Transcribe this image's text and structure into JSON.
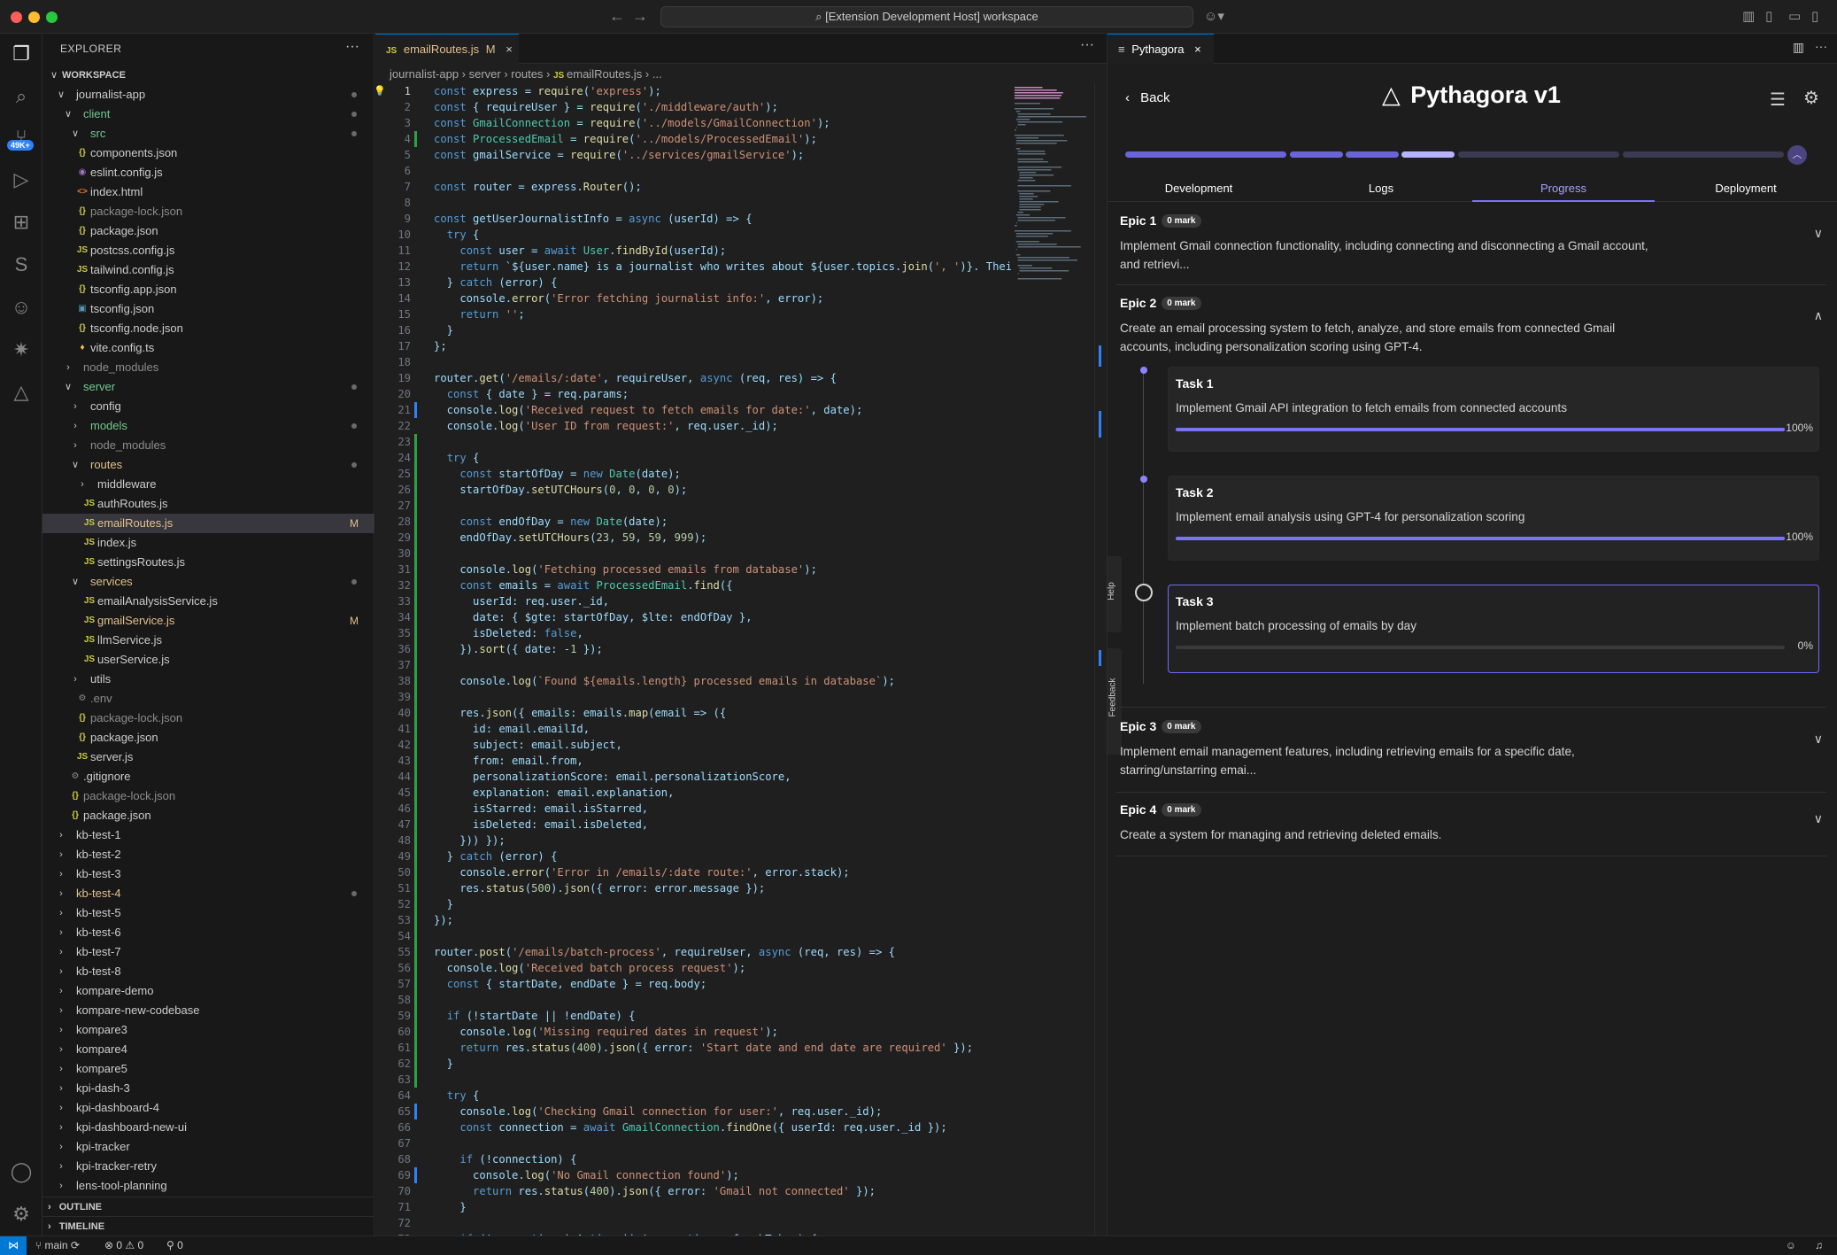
{
  "window": {
    "command_center": "[Extension Development Host] workspace"
  },
  "activity_bar": {
    "badge": "49K+"
  },
  "explorer": {
    "title": "EXPLORER",
    "workspace": "WORKSPACE",
    "items": [
      {
        "label": "journalist-app",
        "depth": 0,
        "type": "folder",
        "open": true,
        "dot": true
      },
      {
        "label": "client",
        "depth": 1,
        "type": "folder",
        "open": true,
        "dot": true,
        "color": "green"
      },
      {
        "label": "src",
        "depth": 2,
        "type": "folder",
        "open": true,
        "dot": true,
        "color": "green"
      },
      {
        "label": "components.json",
        "depth": 2,
        "type": "json"
      },
      {
        "label": "eslint.config.js",
        "depth": 2,
        "type": "eslint"
      },
      {
        "label": "index.html",
        "depth": 2,
        "type": "html"
      },
      {
        "label": "package-lock.json",
        "depth": 2,
        "type": "json",
        "color": "dim"
      },
      {
        "label": "package.json",
        "depth": 2,
        "type": "json"
      },
      {
        "label": "postcss.config.js",
        "depth": 2,
        "type": "js"
      },
      {
        "label": "tailwind.config.js",
        "depth": 2,
        "type": "js"
      },
      {
        "label": "tsconfig.app.json",
        "depth": 2,
        "type": "json"
      },
      {
        "label": "tsconfig.json",
        "depth": 2,
        "type": "ts"
      },
      {
        "label": "tsconfig.node.json",
        "depth": 2,
        "type": "json"
      },
      {
        "label": "vite.config.ts",
        "depth": 2,
        "type": "vite"
      },
      {
        "label": "node_modules",
        "depth": 1,
        "type": "folder",
        "open": false,
        "color": "dim"
      },
      {
        "label": "server",
        "depth": 1,
        "type": "folder",
        "open": true,
        "dot": true,
        "color": "green"
      },
      {
        "label": "config",
        "depth": 2,
        "type": "folder",
        "open": false
      },
      {
        "label": "models",
        "depth": 2,
        "type": "folder",
        "open": false,
        "dot": true,
        "color": "green"
      },
      {
        "label": "node_modules",
        "depth": 2,
        "type": "folder",
        "open": false,
        "color": "dim"
      },
      {
        "label": "routes",
        "depth": 2,
        "type": "folder",
        "open": true,
        "dot": true,
        "color": "gold"
      },
      {
        "label": "middleware",
        "depth": 3,
        "type": "folder",
        "open": false
      },
      {
        "label": "authRoutes.js",
        "depth": 3,
        "type": "js"
      },
      {
        "label": "emailRoutes.js",
        "depth": 3,
        "type": "js",
        "selected": true,
        "mod": "M",
        "color": "gold"
      },
      {
        "label": "index.js",
        "depth": 3,
        "type": "js"
      },
      {
        "label": "settingsRoutes.js",
        "depth": 3,
        "type": "js"
      },
      {
        "label": "services",
        "depth": 2,
        "type": "folder",
        "open": true,
        "dot": true,
        "color": "gold"
      },
      {
        "label": "emailAnalysisService.js",
        "depth": 3,
        "type": "js"
      },
      {
        "label": "gmailService.js",
        "depth": 3,
        "type": "js",
        "mod": "M",
        "color": "gold"
      },
      {
        "label": "llmService.js",
        "depth": 3,
        "type": "js"
      },
      {
        "label": "userService.js",
        "depth": 3,
        "type": "js"
      },
      {
        "label": "utils",
        "depth": 2,
        "type": "folder",
        "open": false
      },
      {
        "label": ".env",
        "depth": 2,
        "type": "gear",
        "color": "dim"
      },
      {
        "label": "package-lock.json",
        "depth": 2,
        "type": "json",
        "color": "dim"
      },
      {
        "label": "package.json",
        "depth": 2,
        "type": "json"
      },
      {
        "label": "server.js",
        "depth": 2,
        "type": "js"
      },
      {
        "label": ".gitignore",
        "depth": 1,
        "type": "gear"
      },
      {
        "label": "package-lock.json",
        "depth": 1,
        "type": "json",
        "color": "dim"
      },
      {
        "label": "package.json",
        "depth": 1,
        "type": "json"
      },
      {
        "label": "kb-test-1",
        "depth": 0,
        "type": "folder",
        "open": false
      },
      {
        "label": "kb-test-2",
        "depth": 0,
        "type": "folder",
        "open": false
      },
      {
        "label": "kb-test-3",
        "depth": 0,
        "type": "folder",
        "open": false
      },
      {
        "label": "kb-test-4",
        "depth": 0,
        "type": "folder",
        "open": false,
        "dot": true,
        "color": "gold"
      },
      {
        "label": "kb-test-5",
        "depth": 0,
        "type": "folder",
        "open": false
      },
      {
        "label": "kb-test-6",
        "depth": 0,
        "type": "folder",
        "open": false
      },
      {
        "label": "kb-test-7",
        "depth": 0,
        "type": "folder",
        "open": false
      },
      {
        "label": "kb-test-8",
        "depth": 0,
        "type": "folder",
        "open": false
      },
      {
        "label": "kompare-demo",
        "depth": 0,
        "type": "folder",
        "open": false
      },
      {
        "label": "kompare-new-codebase",
        "depth": 0,
        "type": "folder",
        "open": false
      },
      {
        "label": "kompare3",
        "depth": 0,
        "type": "folder",
        "open": false
      },
      {
        "label": "kompare4",
        "depth": 0,
        "type": "folder",
        "open": false
      },
      {
        "label": "kompare5",
        "depth": 0,
        "type": "folder",
        "open": false
      },
      {
        "label": "kpi-dash-3",
        "depth": 0,
        "type": "folder",
        "open": false
      },
      {
        "label": "kpi-dashboard-4",
        "depth": 0,
        "type": "folder",
        "open": false
      },
      {
        "label": "kpi-dashboard-new-ui",
        "depth": 0,
        "type": "folder",
        "open": false
      },
      {
        "label": "kpi-tracker",
        "depth": 0,
        "type": "folder",
        "open": false
      },
      {
        "label": "kpi-tracker-retry",
        "depth": 0,
        "type": "folder",
        "open": false
      },
      {
        "label": "lens-tool-planning",
        "depth": 0,
        "type": "folder",
        "open": false
      }
    ],
    "outline": "OUTLINE",
    "timeline": "TIMELINE"
  },
  "editor": {
    "tab_label": "emailRoutes.js",
    "tab_icon": "JS",
    "tab_mod": "M",
    "breadcrumbs": [
      "journalist-app",
      "server",
      "routes",
      "emailRoutes.js",
      "..."
    ],
    "current_line": 1,
    "lines": [
      "const express = require('express');",
      "const { requireUser } = require('./middleware/auth');",
      "const GmailConnection = require('../models/GmailConnection');",
      "const ProcessedEmail = require('../models/ProcessedEmail');",
      "const gmailService = require('../services/gmailService');",
      "",
      "const router = express.Router();",
      "",
      "const getUserJournalistInfo = async (userId) => {",
      "  try {",
      "    const user = await User.findById(userId);",
      "    return `${user.name} is a journalist who writes about ${user.topics.join(', ')}. Their",
      "  } catch (error) {",
      "    console.error('Error fetching journalist info:', error);",
      "    return '';",
      "  }",
      "};",
      "",
      "router.get('/emails/:date', requireUser, async (req, res) => {",
      "  const { date } = req.params;",
      "  console.log('Received request to fetch emails for date:', date);",
      "  console.log('User ID from request:', req.user._id);",
      "",
      "  try {",
      "    const startOfDay = new Date(date);",
      "    startOfDay.setUTCHours(0, 0, 0, 0);",
      "",
      "    const endOfDay = new Date(date);",
      "    endOfDay.setUTCHours(23, 59, 59, 999);",
      "",
      "    console.log('Fetching processed emails from database');",
      "    const emails = await ProcessedEmail.find({",
      "      userId: req.user._id,",
      "      date: { $gte: startOfDay, $lte: endOfDay },",
      "      isDeleted: false,",
      "    }).sort({ date: -1 });",
      "",
      "    console.log(`Found ${emails.length} processed emails in database`);",
      "",
      "    res.json({ emails: emails.map(email => ({",
      "      id: email.emailId,",
      "      subject: email.subject,",
      "      from: email.from,",
      "      personalizationScore: email.personalizationScore,",
      "      explanation: email.explanation,",
      "      isStarred: email.isStarred,",
      "      isDeleted: email.isDeleted,",
      "    })) });",
      "  } catch (error) {",
      "    console.error('Error in /emails/:date route:', error.stack);",
      "    res.status(500).json({ error: error.message });",
      "  }",
      "});",
      "",
      "router.post('/emails/batch-process', requireUser, async (req, res) => {",
      "  console.log('Received batch process request');",
      "  const { startDate, endDate } = req.body;",
      "",
      "  if (!startDate || !endDate) {",
      "    console.log('Missing required dates in request');",
      "    return res.status(400).json({ error: 'Start date and end date are required' });",
      "  }",
      "",
      "  try {",
      "    console.log('Checking Gmail connection for user:', req.user._id);",
      "    const connection = await GmailConnection.findOne({ userId: req.user._id });",
      "",
      "    if (!connection) {",
      "      console.log('No Gmail connection found');",
      "      return res.status(400).json({ error: 'Gmail not connected' });",
      "    }",
      "",
      "    if (!connection.isActive || !connection.refreshToken) {"
    ]
  },
  "pythagora": {
    "tab_label": "Pythagora",
    "back_label": "Back",
    "brand": "Pythagora v1",
    "tabs": [
      {
        "label": "Development",
        "active": false
      },
      {
        "label": "Logs",
        "active": false
      },
      {
        "label": "Progress",
        "active": true
      },
      {
        "label": "Deployment",
        "active": false
      }
    ],
    "epics": [
      {
        "title": "Epic 1",
        "mark": "0 mark",
        "desc": "Implement Gmail connection functionality, including connecting and disconnecting a Gmail account, and retrievi...",
        "expanded": false
      },
      {
        "title": "Epic 2",
        "mark": "0 mark",
        "desc": "Create an email processing system to fetch, analyze, and store emails from connected Gmail accounts, including personalization scoring using GPT-4.",
        "expanded": true
      },
      {
        "title": "Epic 3",
        "mark": "0 mark",
        "desc": "Implement email management features, including retrieving emails for a specific date, starring/unstarring emai...",
        "expanded": false
      },
      {
        "title": "Epic 4",
        "mark": "0 mark",
        "desc": "Create a system for managing and retrieving deleted emails.",
        "expanded": false
      }
    ],
    "tasks": [
      {
        "title": "Task 1",
        "desc": "Implement Gmail API integration to fetch emails from connected accounts",
        "progress": 100,
        "pct_label": "100%"
      },
      {
        "title": "Task 2",
        "desc": "Implement email analysis using GPT-4 for personalization scoring",
        "progress": 100,
        "pct_label": "100%"
      },
      {
        "title": "Task 3",
        "desc": "Implement batch processing of emails by day",
        "progress": 0,
        "pct_label": "0%"
      }
    ],
    "side_help": "Help",
    "side_feedback": "Feedback"
  },
  "status": {
    "branch": "main",
    "errors": "0",
    "warnings": "0",
    "ports": "0"
  },
  "colors": {
    "accent": "#7b74f2",
    "accent_light": "#a5a0ff",
    "blue": "#0078d4"
  }
}
